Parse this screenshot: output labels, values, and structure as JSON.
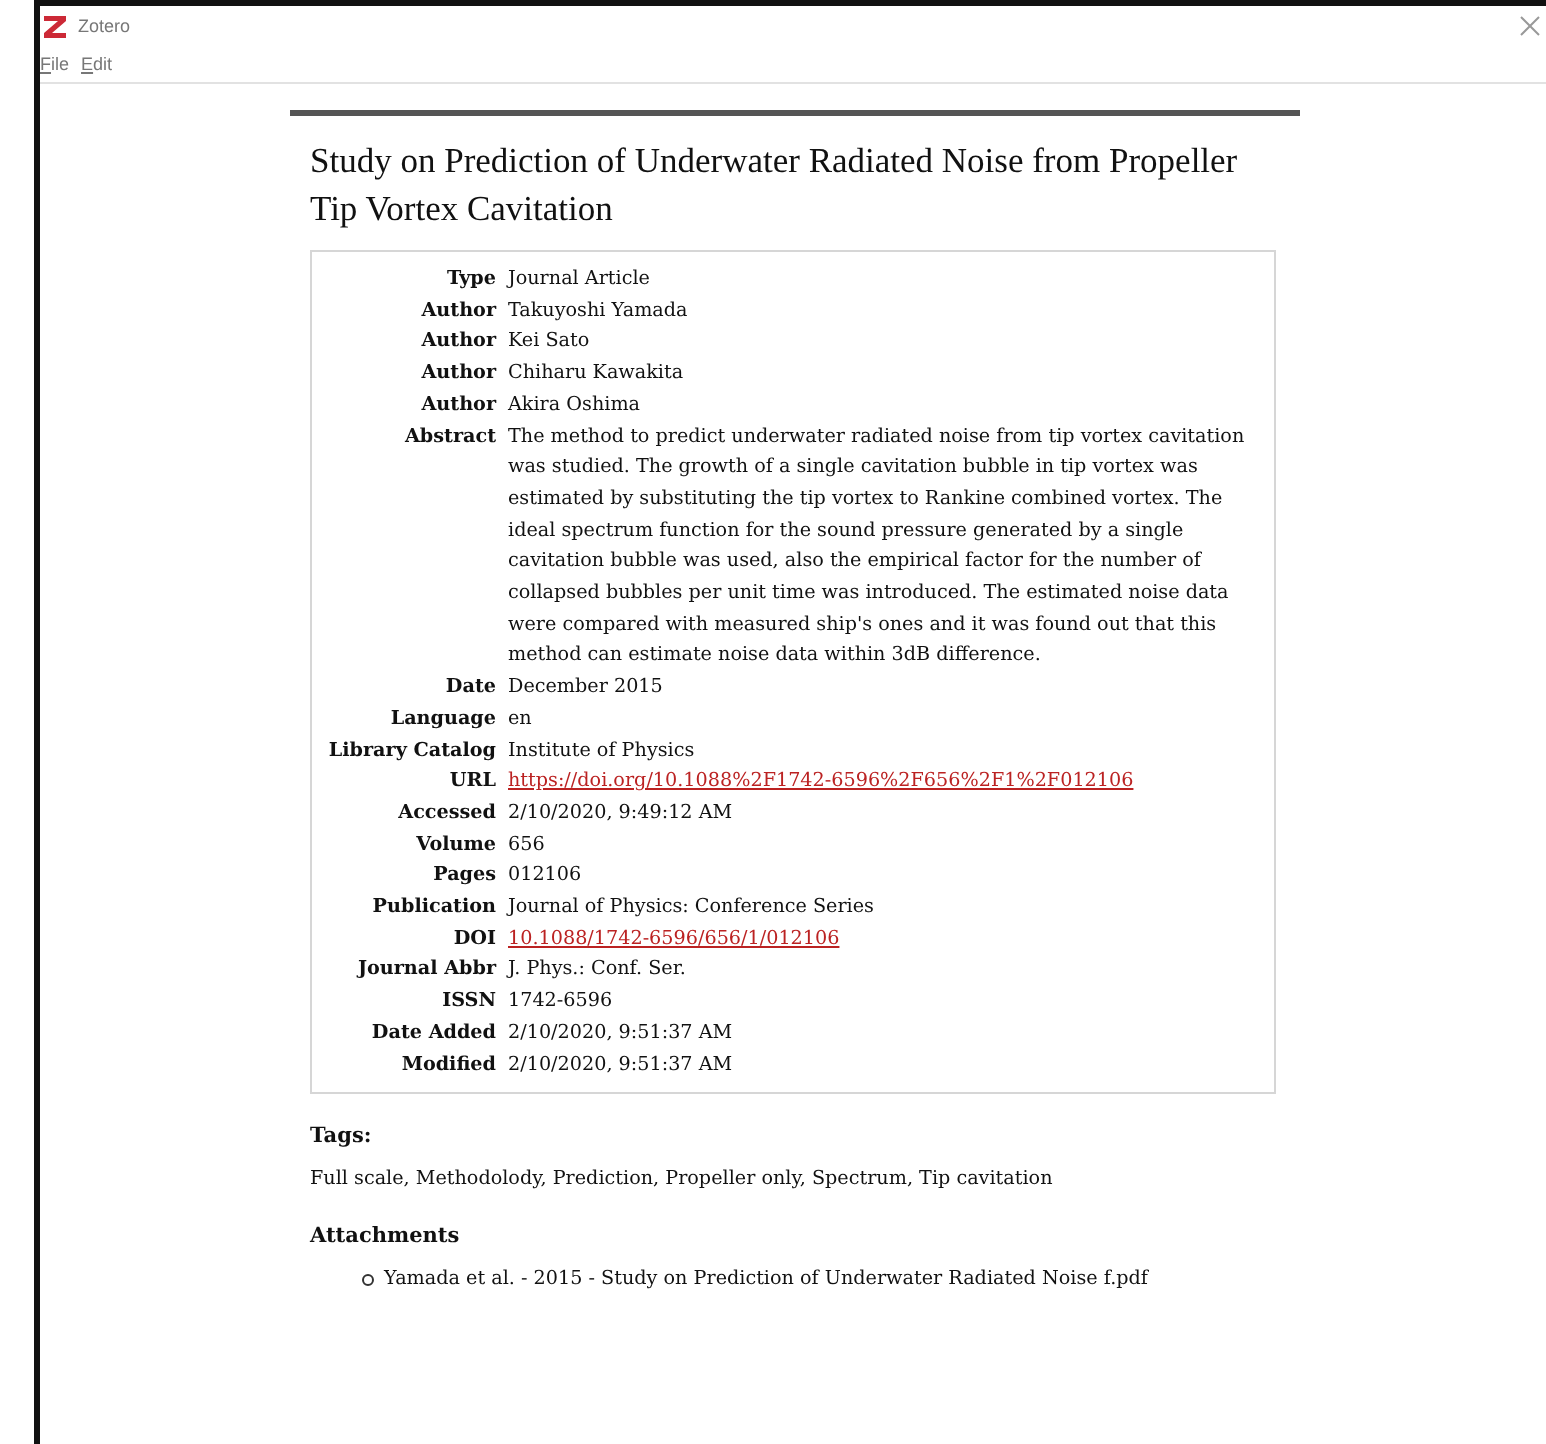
{
  "window": {
    "title": "Zotero"
  },
  "menu": [
    {
      "label": "File"
    },
    {
      "label": "Edit"
    }
  ],
  "item": {
    "title": "Study on Prediction of Underwater Radiated Noise from Propeller Tip Vortex Cavitation",
    "fields": [
      {
        "label": "Type",
        "value": "Journal Article",
        "kind": "text"
      },
      {
        "label": "Author",
        "value": "Takuyoshi Yamada",
        "kind": "text"
      },
      {
        "label": "Author",
        "value": "Kei Sato",
        "kind": "text"
      },
      {
        "label": "Author",
        "value": "Chiharu Kawakita",
        "kind": "text"
      },
      {
        "label": "Author",
        "value": "Akira Oshima",
        "kind": "text"
      },
      {
        "label": "Abstract",
        "value": "The method to predict underwater radiated noise from tip vortex cavitation was studied. The growth of a single cavitation bubble in tip vortex was estimated by substituting the tip vortex to Rankine combined vortex. The ideal spectrum function for the sound pressure generated by a single cavitation bubble was used, also the empirical factor for the number of collapsed bubbles per unit time was introduced. The estimated noise data were compared with measured ship's ones and it was found out that this method can estimate noise data within 3dB difference.",
        "kind": "text"
      },
      {
        "label": "Date",
        "value": "December 2015",
        "kind": "text"
      },
      {
        "label": "Language",
        "value": "en",
        "kind": "text"
      },
      {
        "label": "Library Catalog",
        "value": "Institute of Physics",
        "kind": "text"
      },
      {
        "label": "URL",
        "value": "https://doi.org/10.1088%2F1742-6596%2F656%2F1%2F012106",
        "kind": "link"
      },
      {
        "label": "Accessed",
        "value": "2/10/2020, 9:49:12 AM",
        "kind": "text"
      },
      {
        "label": "Volume",
        "value": "656",
        "kind": "text"
      },
      {
        "label": "Pages",
        "value": "012106",
        "kind": "text"
      },
      {
        "label": "Publication",
        "value": "Journal of Physics: Conference Series",
        "kind": "text"
      },
      {
        "label": "DOI",
        "value": "10.1088/1742-6596/656/1/012106",
        "kind": "link"
      },
      {
        "label": "Journal Abbr",
        "value": "J. Phys.: Conf. Ser.",
        "kind": "text"
      },
      {
        "label": "ISSN",
        "value": "1742-6596",
        "kind": "text"
      },
      {
        "label": "Date Added",
        "value": "2/10/2020, 9:51:37 AM",
        "kind": "text"
      },
      {
        "label": "Modified",
        "value": "2/10/2020, 9:51:37 AM",
        "kind": "text"
      }
    ]
  },
  "tags": {
    "heading": "Tags:",
    "text": "Full scale, Methodolody, Prediction, Propeller only, Spectrum, Tip cavitation"
  },
  "attachments": {
    "heading": "Attachments",
    "items": [
      "Yamada et al. - 2015 - Study on Prediction of Underwater Radiated Noise f.pdf"
    ]
  }
}
